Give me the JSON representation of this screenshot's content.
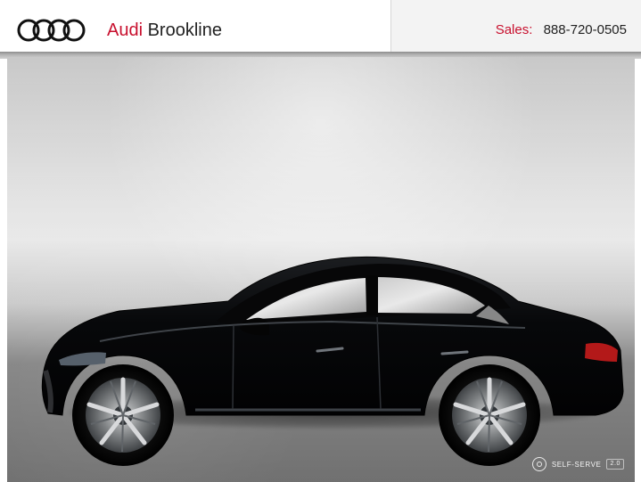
{
  "header": {
    "logo_name": "audi-rings-logo",
    "dealer_brand": "Audi",
    "dealer_location": "Brookline",
    "sales_label": "Sales:",
    "sales_phone": "888-720-0505"
  },
  "photo": {
    "watermark_text": "SELF-SERVE",
    "watermark_version": "2.0"
  },
  "colors": {
    "brand_red": "#c8102e",
    "text_dark": "#222222",
    "header_right_bg": "#f3f3f3"
  }
}
